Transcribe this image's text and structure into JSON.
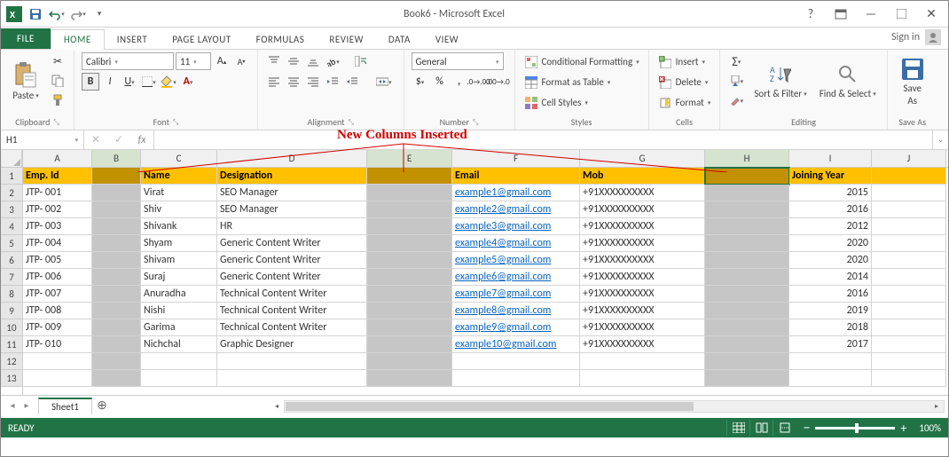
{
  "title": "Book6 - Microsoft Excel",
  "qat": {
    "tooltip_save": "Save",
    "tooltip_undo": "Undo",
    "tooltip_redo": "Redo"
  },
  "tabs": {
    "file": "FILE",
    "home": "HOME",
    "insert": "INSERT",
    "page_layout": "PAGE LAYOUT",
    "formulas": "FORMULAS",
    "review": "REVIEW",
    "data": "DATA",
    "view": "VIEW"
  },
  "signin": "Sign in",
  "ribbon": {
    "clipboard": {
      "paste": "Paste",
      "name": "Clipboard"
    },
    "font": {
      "family": "Calibri",
      "size": "11",
      "name": "Font"
    },
    "alignment": {
      "name": "Alignment"
    },
    "number": {
      "format": "General",
      "name": "Number"
    },
    "styles": {
      "cond": "Conditional Formatting",
      "table": "Format as Table",
      "cell": "Cell Styles",
      "name": "Styles"
    },
    "cells": {
      "insert": "Insert",
      "delete": "Delete",
      "format": "Format",
      "name": "Cells"
    },
    "editing": {
      "sort": "Sort & Filter",
      "find": "Find & Select",
      "name": "Editing"
    },
    "saveas": {
      "label1": "Save",
      "label2": "As",
      "name": "Save As"
    }
  },
  "formula_bar": {
    "name": "H1",
    "fx": "fx"
  },
  "annotation": "New Columns Inserted",
  "col_letters": [
    "A",
    "B",
    "C",
    "D",
    "E",
    "F",
    "G",
    "H",
    "I",
    "J"
  ],
  "selected_cols": [
    "B",
    "E",
    "H"
  ],
  "row_count": 13,
  "headers": {
    "A": "Emp. Id",
    "C": "Name",
    "D": "Designation",
    "F": "Email",
    "G": "Mob",
    "I": "Joining Year"
  },
  "rows": [
    {
      "A": "JTP- 001",
      "C": "Virat",
      "D": "SEO Manager",
      "F": "example1@gmail.com",
      "G": "+91XXXXXXXXXX",
      "I": "2015"
    },
    {
      "A": "JTP- 002",
      "C": "Shiv",
      "D": "SEO Manager",
      "F": "example2@gmail.com",
      "G": "+91XXXXXXXXXX",
      "I": "2016"
    },
    {
      "A": "JTP- 003",
      "C": "Shivank",
      "D": "HR",
      "F": "example3@gmail.com",
      "G": "+91XXXXXXXXXX",
      "I": "2012"
    },
    {
      "A": "JTP- 004",
      "C": "Shyam",
      "D": "Generic Content Writer",
      "F": "example4@gmail.com",
      "G": "+91XXXXXXXXXX",
      "I": "2020"
    },
    {
      "A": "JTP- 005",
      "C": "Shivam",
      "D": "Generic Content Writer",
      "F": "example5@gmail.com",
      "G": "+91XXXXXXXXXX",
      "I": "2020"
    },
    {
      "A": "JTP- 006",
      "C": "Suraj",
      "D": "Generic Content Writer",
      "F": "example6@gmail.com",
      "G": "+91XXXXXXXXXX",
      "I": "2014"
    },
    {
      "A": "JTP- 007",
      "C": "Anuradha",
      "D": "Technical Content Writer",
      "F": "example7@gmail.com",
      "G": "+91XXXXXXXXXX",
      "I": "2016"
    },
    {
      "A": "JTP- 008",
      "C": "Nishi",
      "D": "Technical Content Writer",
      "F": "example8@gmail.com",
      "G": "+91XXXXXXXXXX",
      "I": "2019"
    },
    {
      "A": "JTP- 009",
      "C": "Garima",
      "D": "Technical Content Writer",
      "F": "example9@gmail.com",
      "G": "+91XXXXXXXXXX",
      "I": "2018"
    },
    {
      "A": "JTP- 010",
      "C": "Nichchal",
      "D": "Graphic Designer",
      "F": "example10@gmail.com",
      "G": "+91XXXXXXXXXX",
      "I": "2017"
    }
  ],
  "sheet": {
    "name": "Sheet1"
  },
  "status": {
    "ready": "READY",
    "zoom": "100%"
  }
}
